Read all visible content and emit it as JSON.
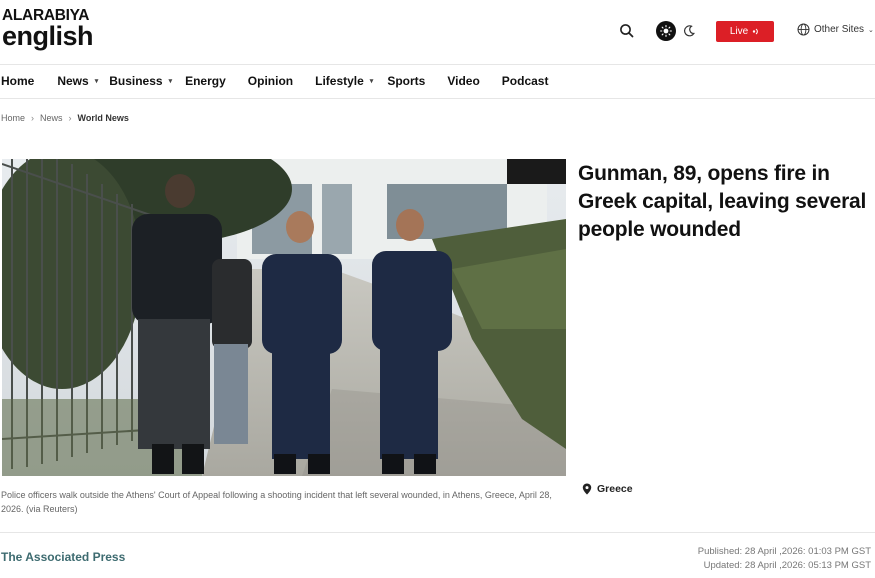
{
  "brand": {
    "top": "ALARABIYA",
    "bottom": "english"
  },
  "header": {
    "search_icon": "search-icon",
    "live_label": "Live",
    "other_sites_label": "Other Sites"
  },
  "nav": {
    "items": [
      {
        "label": "Home",
        "dropdown": false
      },
      {
        "label": "News",
        "dropdown": true
      },
      {
        "label": "Business",
        "dropdown": true
      },
      {
        "label": "Energy",
        "dropdown": false
      },
      {
        "label": "Opinion",
        "dropdown": false
      },
      {
        "label": "Lifestyle",
        "dropdown": true
      },
      {
        "label": "Sports",
        "dropdown": false
      },
      {
        "label": "Video",
        "dropdown": false
      },
      {
        "label": "Podcast",
        "dropdown": false
      }
    ]
  },
  "breadcrumb": {
    "home": "Home",
    "news": "News",
    "current": "World News"
  },
  "article": {
    "headline": "Gunman, 89, opens fire in Greek capital, leaving several people wounded",
    "caption": "Police officers walk outside the Athens' Court of Appeal following a shooting incident that left several wounded, in Athens, Greece, April 28, 2026. (via Reuters)",
    "location": "Greece",
    "source": "The Associated Press",
    "published": "Published: 28 April ,2026: 01:03 PM GST",
    "updated": "Updated: 28 April ,2026: 05:13 PM GST"
  },
  "colors": {
    "live": "#dc1f26",
    "source": "#3d6b70"
  }
}
